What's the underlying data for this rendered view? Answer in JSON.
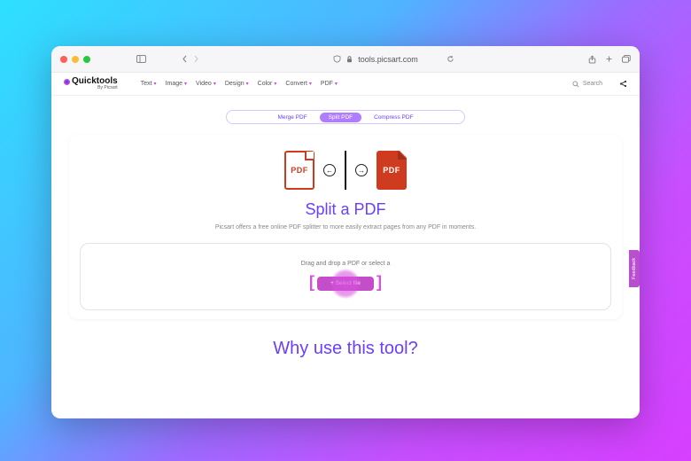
{
  "browser": {
    "url_host": "tools.picsart.com"
  },
  "header": {
    "logo_main": "Quicktools",
    "logo_sub": "By Picsart",
    "nav": [
      "Text",
      "Image",
      "Video",
      "Design",
      "Color",
      "Convert",
      "PDF"
    ],
    "search_placeholder": "Search"
  },
  "pills": {
    "items": [
      "Merge PDF",
      "Split PDF",
      "Compress PDF"
    ],
    "active_index": 1
  },
  "hero": {
    "doc_label": "PDF",
    "title": "Split a PDF",
    "subtitle": "Picsart offers a free online PDF splitter to more easily extract pages from any PDF in moments."
  },
  "dropzone": {
    "instruction": "Drag and drop a PDF or select a",
    "button_label": "+  Select file"
  },
  "section2_title": "Why use this tool?",
  "feedback_label": "Feedback",
  "colors": {
    "accent": "#6a3fff",
    "magenta": "#c44ec9",
    "pdf_red": "#cf3b1f"
  }
}
